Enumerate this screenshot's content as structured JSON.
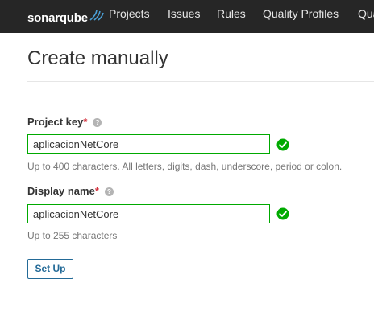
{
  "navbar": {
    "logo_text": "sonarqube",
    "items": [
      {
        "label": "Projects"
      },
      {
        "label": "Issues"
      },
      {
        "label": "Rules"
      },
      {
        "label": "Quality Profiles"
      },
      {
        "label": "Qua"
      }
    ]
  },
  "page": {
    "title": "Create manually"
  },
  "form": {
    "project_key": {
      "label": "Project key",
      "required_mark": "*",
      "value": "aplicacionNetCore",
      "help": "Up to 400 characters. All letters, digits, dash, underscore, period or colon."
    },
    "display_name": {
      "label": "Display name",
      "required_mark": "*",
      "value": "aplicacionNetCore",
      "help": "Up to 255 characters"
    },
    "submit_label": "Set Up"
  },
  "colors": {
    "navbar_bg": "#262626",
    "valid_green": "#00aa00",
    "required_red": "#d4333f",
    "button_blue": "#236a97"
  }
}
